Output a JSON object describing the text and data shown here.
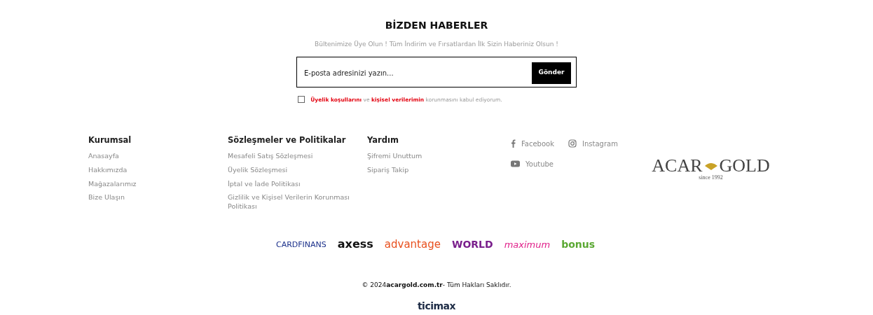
{
  "newsletter": {
    "title": "BİZDEN HABERLER",
    "subtitle": "Bültenimize Üye Olun ! Tüm İndirim ve Fırsatlardan İlk Sizin Haberiniz Olsun !",
    "email": {
      "placeholder": "E-posta adresinizi yazın..."
    },
    "button": "Gönder",
    "consent": {
      "checked": false,
      "text": "**Üyelik koşullarını** ve **kişisel verilerimin** korunmasını kabul ediyorum."
    }
  },
  "footer_columns": [
    {
      "title": "Kurumsal",
      "links": [
        "Anasayfa",
        "Hakkımızda",
        "Mağazalarımız",
        "Bize Ulaşın"
      ]
    },
    {
      "title": "Sözleşmeler ve Politikalar",
      "links": [
        "Mesafeli Satış Sözleşmesi",
        "Üyelik Sözleşmesi",
        "İptal ve İade Politikası",
        "Gizlilik ve Kişisel Verilerin Korunması Politikası"
      ]
    },
    {
      "title": "Yardım",
      "links": [
        "Şifremi Unuttum",
        "Sipariş Takip"
      ]
    }
  ],
  "social": [
    {
      "kind": "facebook",
      "label": "Facebook"
    },
    {
      "kind": "instagram",
      "label": "Instagram"
    },
    {
      "kind": "youtube",
      "label": "Youtube"
    }
  ],
  "brand_logo": {
    "left": "ACAR",
    "right": "GOLD",
    "tagline": "since 1992"
  },
  "card_logos": [
    {
      "kind": "cardfinans",
      "text": "CARDFINANS",
      "color": "#1a2f8a"
    },
    {
      "kind": "axess",
      "text": "axess",
      "color": "#111111"
    },
    {
      "kind": "advantage",
      "text": "advantage",
      "color": "#e8501e"
    },
    {
      "kind": "world",
      "text": "WORLD",
      "color": "#7a1f8c"
    },
    {
      "kind": "maximum",
      "text": "maximum",
      "color": "#e0218a"
    },
    {
      "kind": "bonus",
      "text": "bonus",
      "color": "#5aa832"
    }
  ],
  "copyright": "© 2024**acargold.com.tr**- Tüm Hakları Saklıdır.",
  "platform_logo": "ticimax"
}
